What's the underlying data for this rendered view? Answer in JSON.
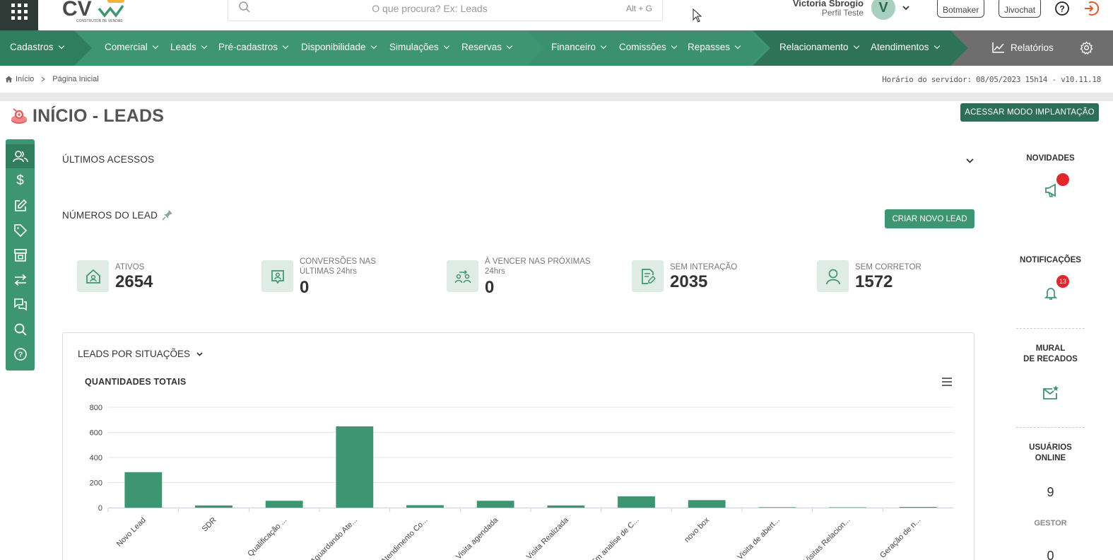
{
  "header": {
    "search_placeholder": "O que procura? Ex: Leads",
    "search_shortcut": "Alt + G",
    "user_name": "Victoria Sbrogio",
    "user_profile": "Perfil Teste",
    "avatar_letter": "V",
    "botmaker_label": "Botmaker",
    "jivochat_label": "Jivochat"
  },
  "nav": {
    "cadastros": "Cadastros",
    "comercial": "Comercial",
    "leads": "Leads",
    "pre_cadastros": "Pré-cadastros",
    "disponibilidade": "Disponibilidade",
    "simulacoes": "Simulações",
    "reservas": "Reservas",
    "financeiro": "Financeiro",
    "comissoes": "Comissões",
    "repasses": "Repasses",
    "relacionamento": "Relacionamento",
    "atendimentos": "Atendimentos",
    "relatorios": "Relatórios"
  },
  "breadcrumb": {
    "home": "Início",
    "current": "Página Inicial"
  },
  "server_time": "Horário do servidor: 08/05/2023 15h14 - v10.11.18",
  "page": {
    "title": "INÍCIO - LEADS",
    "implant_button": "ACESSAR MODO IMPLANTAÇÃO",
    "recent_access_title": "ÚLTIMOS ACESSOS",
    "lead_numbers_title": "NÚMEROS DO LEAD",
    "create_lead_button": "CRIAR NOVO LEAD"
  },
  "stats": [
    {
      "label": "ATIVOS",
      "value": "2654",
      "icon": "house-icon"
    },
    {
      "label": "CONVERSÕES NAS ÚLTIMAS 24hrs",
      "value": "0",
      "icon": "conversion-icon"
    },
    {
      "label": "À VENCER NAS PRÓXIMAS 24hrs",
      "value": "0",
      "icon": "people-exchange-icon"
    },
    {
      "label": "SEM INTERAÇÃO",
      "value": "2035",
      "icon": "document-edit-icon"
    },
    {
      "label": "SEM CORRETOR",
      "value": "1572",
      "icon": "user-icon"
    }
  ],
  "card": {
    "title": "LEADS POR SITUAÇÕES",
    "chart_title": "QUANTIDADES TOTAIS"
  },
  "chart_data": {
    "type": "bar",
    "title": "QUANTIDADES TOTAIS",
    "categories": [
      "Novo Lead",
      "SDR",
      "Qualificação ...",
      "Aguardando Ate...",
      "Atendimento Co...",
      "Visita agendada",
      "Visita Realizada",
      "Em analise de C...",
      "novo box",
      "Visita de abert...",
      "Visitas Relacion...",
      "Geração de n..."
    ],
    "values": [
      283,
      18,
      55,
      648,
      20,
      55,
      18,
      90,
      60,
      4,
      3,
      6
    ],
    "ylim": [
      0,
      800
    ],
    "yticks": [
      0,
      200,
      400,
      600,
      800
    ],
    "color": "#3d9571",
    "grid": true
  },
  "rail": {
    "news": "NOVIDADES",
    "notifications": "NOTIFICAÇÕES",
    "notifications_count": "13",
    "board_line1": "MURAL",
    "board_line2": "DE RECADOS",
    "online_line1": "USUÁRIOS",
    "online_line2": "ONLINE",
    "online_count": "9",
    "manager_label": "GESTOR",
    "manager_count": "0"
  }
}
